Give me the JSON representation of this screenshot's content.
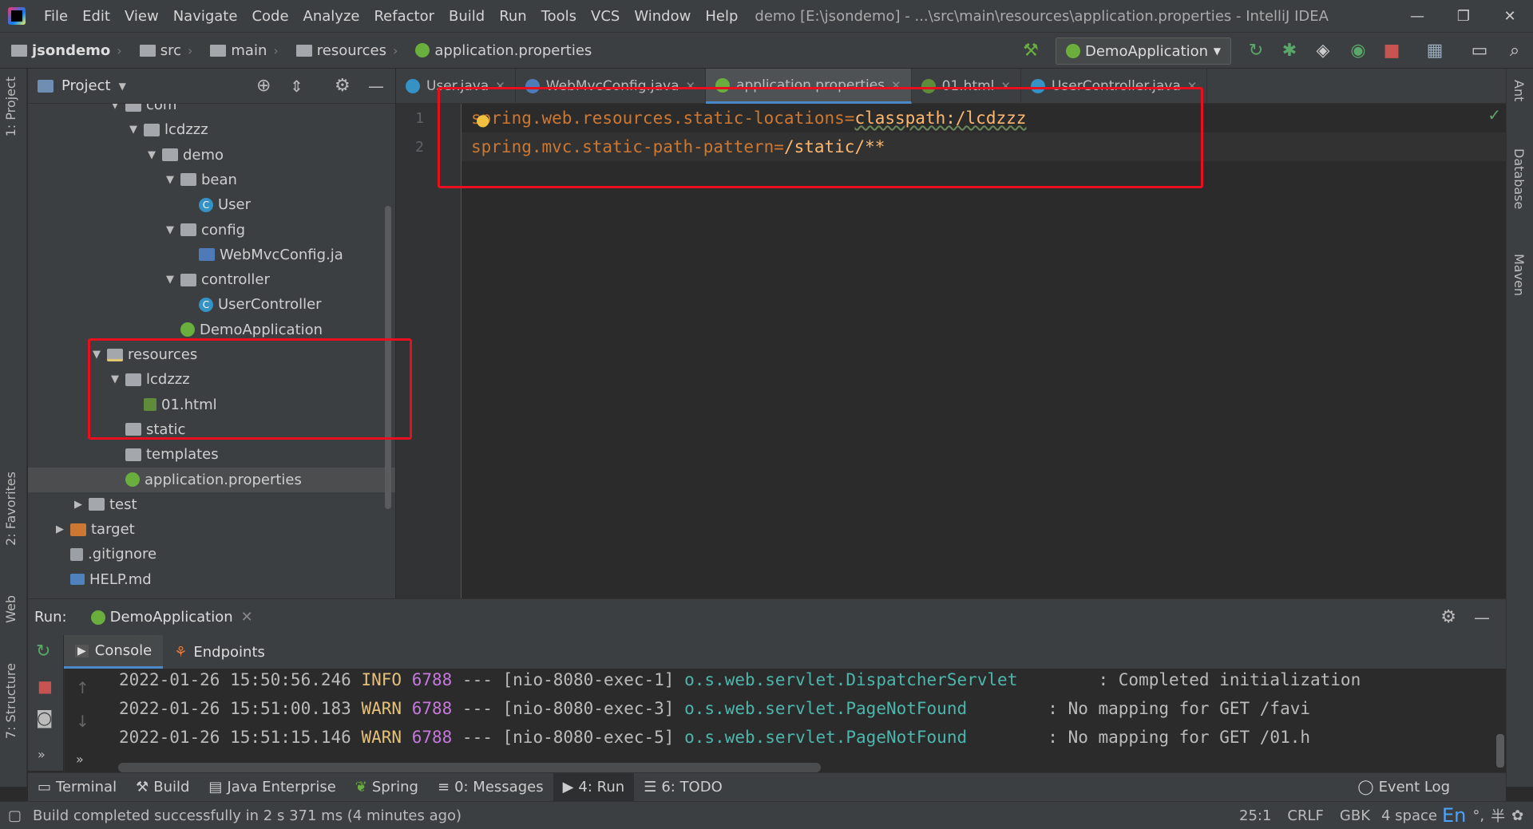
{
  "window": {
    "title": "demo [E:\\jsondemo] - ...\\src\\main\\resources\\application.properties - IntelliJ IDEA",
    "menu": [
      "File",
      "Edit",
      "View",
      "Navigate",
      "Code",
      "Analyze",
      "Refactor",
      "Build",
      "Run",
      "Tools",
      "VCS",
      "Window",
      "Help"
    ]
  },
  "breadcrumb": [
    "jsondemo",
    "src",
    "main",
    "resources",
    "application.properties"
  ],
  "run_config": "DemoApplication",
  "project_panel": {
    "title": "Project",
    "tree": [
      {
        "label": "com",
        "depth": 4,
        "toggle": "▼",
        "icon": "folder"
      },
      {
        "label": "lcdzzz",
        "depth": 5,
        "toggle": "▼",
        "icon": "folder"
      },
      {
        "label": "demo",
        "depth": 6,
        "toggle": "▼",
        "icon": "folder"
      },
      {
        "label": "bean",
        "depth": 7,
        "toggle": "▼",
        "icon": "folder"
      },
      {
        "label": "User",
        "depth": 8,
        "toggle": "",
        "icon": "cls"
      },
      {
        "label": "config",
        "depth": 7,
        "toggle": "▼",
        "icon": "folder"
      },
      {
        "label": "WebMvcConfig.ja",
        "depth": 8,
        "toggle": "",
        "icon": "java"
      },
      {
        "label": "controller",
        "depth": 7,
        "toggle": "▼",
        "icon": "folder"
      },
      {
        "label": "UserController",
        "depth": 8,
        "toggle": "",
        "icon": "cls"
      },
      {
        "label": "DemoApplication",
        "depth": 7,
        "toggle": "",
        "icon": "spring"
      },
      {
        "label": "resources",
        "depth": 3,
        "toggle": "▼",
        "icon": "res"
      },
      {
        "label": "lcdzzz",
        "depth": 4,
        "toggle": "▼",
        "icon": "folder"
      },
      {
        "label": "01.html",
        "depth": 5,
        "toggle": "",
        "icon": "html"
      },
      {
        "label": "static",
        "depth": 4,
        "toggle": "",
        "icon": "folder"
      },
      {
        "label": "templates",
        "depth": 4,
        "toggle": "",
        "icon": "folder"
      },
      {
        "label": "application.properties",
        "depth": 4,
        "toggle": "",
        "icon": "spring"
      },
      {
        "label": "test",
        "depth": 2,
        "toggle": "▶",
        "icon": "folder"
      },
      {
        "label": "target",
        "depth": 1,
        "toggle": "▶",
        "icon": "orange"
      },
      {
        "label": ".gitignore",
        "depth": 1,
        "toggle": "",
        "icon": "file"
      },
      {
        "label": "HELP.md",
        "depth": 1,
        "toggle": "",
        "icon": "md"
      }
    ]
  },
  "editor_tabs": [
    {
      "label": "User.java",
      "color": "#3592c4"
    },
    {
      "label": "WebMvcConfig.java",
      "color": "#4e7bb8"
    },
    {
      "label": "application.properties",
      "color": "#6aaf3d"
    },
    {
      "label": "01.html",
      "color": "#5e8c3a"
    },
    {
      "label": "UserController.java",
      "color": "#3592c4"
    }
  ],
  "editor": {
    "lines": [
      {
        "num": "1",
        "key": "spring.web.resources.static-locations",
        "eq": "=",
        "val": "classpath:/lcdzzz"
      },
      {
        "num": "2",
        "key": "spring.mvc.static-path-pattern",
        "eq": "=",
        "val": "/static/**"
      }
    ]
  },
  "run_panel": {
    "label": "Run:",
    "config": "DemoApplication",
    "tabs": [
      "Console",
      "Endpoints"
    ],
    "log": [
      {
        "ts": "2022-01-26 15:50:56.246",
        "level": "INFO",
        "pid": "6788",
        "sep": "---",
        "thread": "[nio-8080-exec-1]",
        "logger": "o.s.web.servlet.DispatcherServlet",
        "msg": ": Completed initialization"
      },
      {
        "ts": "2022-01-26 15:51:00.183",
        "level": "WARN",
        "pid": "6788",
        "sep": "---",
        "thread": "[nio-8080-exec-3]",
        "logger": "o.s.web.servlet.PageNotFound",
        "msg": ": No mapping for GET /favi"
      },
      {
        "ts": "2022-01-26 15:51:15.146",
        "level": "WARN",
        "pid": "6788",
        "sep": "---",
        "thread": "[nio-8080-exec-5]",
        "logger": "o.s.web.servlet.PageNotFound",
        "msg": ": No mapping for GET /01.h"
      }
    ]
  },
  "tool_windows": [
    "Terminal",
    "Build",
    "Java Enterprise",
    "Spring",
    "0: Messages",
    "4: Run",
    "6: TODO"
  ],
  "event_log": "Event Log",
  "left_stripe": [
    "1: Project",
    "2: Favorites",
    "Web",
    "7: Structure"
  ],
  "right_stripe": [
    "Ant",
    "Database",
    "Maven"
  ],
  "status": {
    "message": "Build completed successfully in 2 s 371 ms (4 minutes ago)",
    "position": "25:1",
    "line_sep": "CRLF",
    "encoding": "GBK",
    "indent": "4 space",
    "ime": "En"
  }
}
